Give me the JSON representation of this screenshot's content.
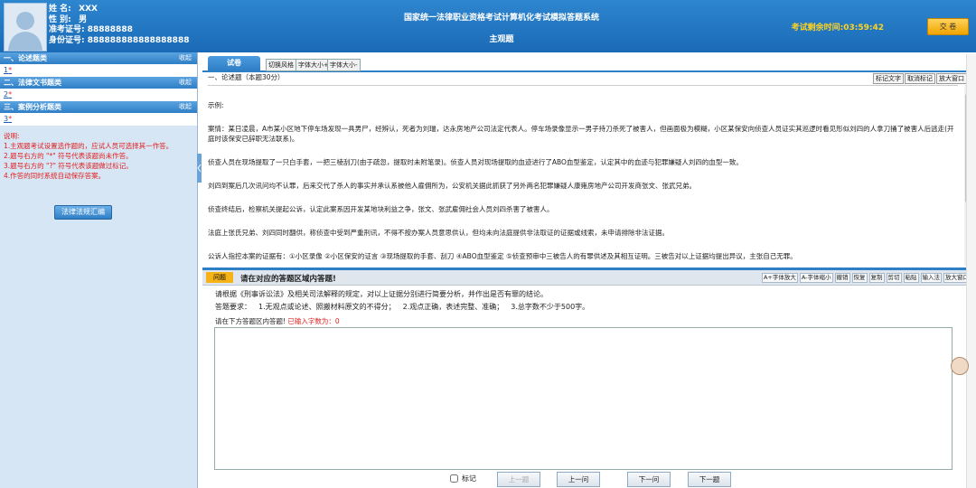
{
  "candidate": {
    "name_label": "姓 名:",
    "name": "XXX",
    "gender_label": "性 别:",
    "gender": "男",
    "admission_label": "准考证号:",
    "admission": "88888888",
    "id_label": "身份证号:",
    "id": "888888888888888888"
  },
  "system": {
    "title": "国家统一法律职业资格考试计算机化考试模拟答题系统",
    "subtitle": "主观题",
    "timer_label": "考试剩余时间:",
    "timer": "03:59:42",
    "submit": "交 卷"
  },
  "sidebar": {
    "collapse_label": "收起",
    "sections": [
      {
        "title": "一、论述题类",
        "num": "1",
        "star": "*"
      },
      {
        "title": "二、法律文书题类",
        "num": "2",
        "star": "*"
      },
      {
        "title": "三、案例分析题类",
        "num": "3",
        "star": "*"
      }
    ],
    "notes_title": "说明:",
    "notes": [
      "1.主观题考试设置选作题的，应试人员可选择其一作答。",
      "2.题号右方的 \"*\" 符号代表该题尚未作答。",
      "3.题号右方的 \"?\" 符号代表该题做过标记。",
      "4.作答的同时系统自动保存答案。"
    ],
    "law_button": "法律法规汇编"
  },
  "tabs": {
    "main": "试卷",
    "buttons": [
      "切换风格",
      "字体大小+",
      "字体大小-"
    ]
  },
  "section_title": "一、论述题（本题30分）",
  "top_buttons": [
    "标记文字",
    "取消标记",
    "放大窗口"
  ],
  "question": {
    "paragraphs": [
      "示例:",
      "案情：某日凌晨，A市某小区地下停车场发现一具男尸，经辨认，死者为刘瑞，达永房地产公司法定代表人。停车场录像显示一男子持刀杀死了被害人，但画面极为模糊，小区某保安向侦查人员证实其巡逻时看见形似刘四的人拿刀捅了被害人后逃走(开庭时该保安已辞职无法联系)。",
      "侦查人员在现场提取了一只白手套，一把三棱刮刀(由于疏忽，提取时未附笔录)。侦查人员对现场提取的血迹进行了ABO血型鉴定，认定其中的血迹与犯罪嫌疑人刘四的血型一致。",
      "刘四到案后几次讯问均不认罪，后来交代了杀人的事实并承认系被他人雇佣所为，公安机关据此抓获了另外两名犯罪嫌疑人康雍房地产公司开发商张文、张武兄弟。",
      "侦查终结后，检察机关提起公诉，认定此案系因开发某地块利益之争，张文、张武雇佣社会人员刘四杀害了被害人。",
      "法庭上张氏兄弟、刘四同时翻供，称侦查中受到严重刑讯，不得不按办案人员意思供认，但均未向法庭提供非法取证的证据或线索，未申请排除非法证据。",
      "公诉人指控本案的证据有：①小区录像 ②小区保安的证言 ③现场提取的手套、刮刀 ④ABO血型鉴定 ⑤侦查预审中三被告人的有罪供述及其相互证明。三被告对以上证据均提出异议，主张自己无罪。"
    ]
  },
  "answer": {
    "label": "问题",
    "title": "请在对应的答题区域内答题!",
    "tools": [
      "A+字体放大",
      "A-字体缩小",
      "撤销",
      "恢复",
      "复制",
      "剪切",
      "粘贴",
      "输入法",
      "放大窗口"
    ],
    "requirement": "请根据《刑事诉讼法》及相关司法解释的规定，对以上证据分别进行简要分析，并作出是否有罪的结论。",
    "req_label": "答题要求：",
    "req_items": [
      "1.无观点或论述、照搬材料原文的不得分；",
      "2.观点正确，表述完整、准确；",
      "3.总字数不少于500字。"
    ],
    "prompt": "请在下方答题区内答题!",
    "count_label": "已输入字数为：",
    "count": "0",
    "value": ""
  },
  "nav": {
    "mark": "标记",
    "prev_type": "上一题",
    "prev": "上一问",
    "next": "下一问",
    "next_type": "下一题"
  }
}
